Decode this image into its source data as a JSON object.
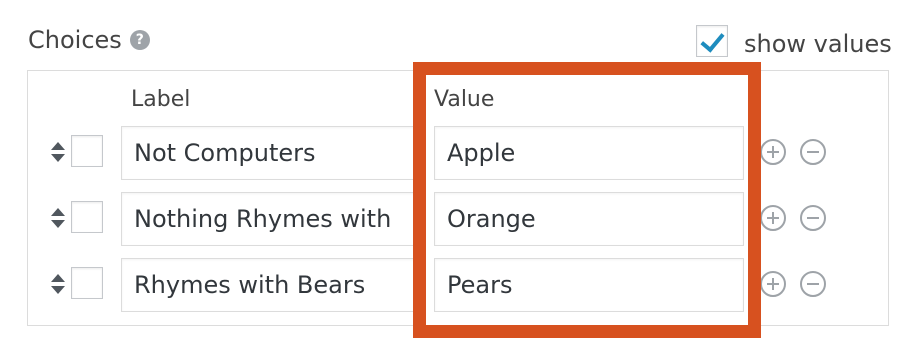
{
  "choices": {
    "title": "Choices",
    "help_icon": "question-circle-icon",
    "show_values_label": "show values",
    "show_values_checked": true
  },
  "columns": {
    "label": "Label",
    "value": "Value"
  },
  "rows": [
    {
      "label": "Not Computers",
      "value": "Apple"
    },
    {
      "label": "Nothing Rhymes with",
      "value": "Orange"
    },
    {
      "label": "Rhymes with Bears",
      "value": "Pears"
    }
  ],
  "colors": {
    "highlight": "#d7511f",
    "checkmark": "#1e8cbe"
  }
}
